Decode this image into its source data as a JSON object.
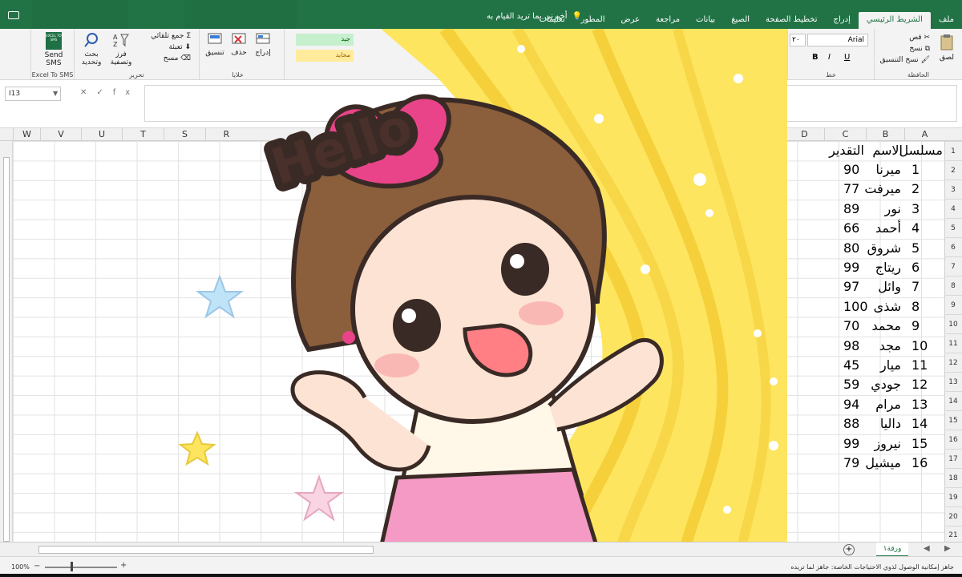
{
  "titlebar": {
    "tabs": [
      "ملف",
      "الشريط الرئيسي",
      "إدراج",
      "تخطيط الصفحة",
      "الصيغ",
      "بيانات",
      "مراجعة",
      "عرض",
      "المطور",
      "تعليمات"
    ],
    "active_tab": "الشريط الرئيسي",
    "tell_me": "أخبرني بما تريد القيام به"
  },
  "ribbon": {
    "clipboard": {
      "paste": "لصق",
      "cut": "قص",
      "copy": "نسخ",
      "format_painter": "نسخ التنسيق",
      "label": "الحافظة"
    },
    "font": {
      "name": "Arial",
      "size": "٢٠",
      "bold": "B",
      "italic": "I",
      "underline": "U",
      "label": "خط"
    },
    "styles": {
      "good": "جيد",
      "neutral": "محايد"
    },
    "cells": {
      "insert": "إدراج",
      "delete": "حذف",
      "format": "تنسيق",
      "label": "خلايا"
    },
    "editing": {
      "autosum": "جمع تلقائي",
      "fill": "تعبئة",
      "clear": "مسح",
      "sort": "فرز وتصفية",
      "find": "بحث وتحديد",
      "label": "تحرير"
    },
    "sms": {
      "logo": "EXCEL TO SMS",
      "button": "Send SMS",
      "label": "Excel To SMS"
    }
  },
  "formula_bar": {
    "name_box": "I13",
    "fx": "fx",
    "value": ""
  },
  "columns": [
    "A",
    "B",
    "C",
    "D",
    "R",
    "S",
    "T",
    "U",
    "V",
    "W"
  ],
  "rows": [
    "1",
    "2",
    "3",
    "4",
    "5",
    "6",
    "7",
    "8",
    "9",
    "10",
    "11",
    "12",
    "13",
    "14",
    "15",
    "16",
    "17",
    "18",
    "19",
    "20",
    "21"
  ],
  "table": {
    "headers": [
      "مسلسل",
      "الاسم",
      "التقدير"
    ],
    "rows": [
      [
        "1",
        "ميرنا",
        "90"
      ],
      [
        "2",
        "ميرفت",
        "77"
      ],
      [
        "3",
        "نور",
        "89"
      ],
      [
        "4",
        "أحمد",
        "66"
      ],
      [
        "5",
        "شروق",
        "80"
      ],
      [
        "6",
        "ريتاج",
        "99"
      ],
      [
        "7",
        "وائل",
        "97"
      ],
      [
        "8",
        "شذى",
        "100"
      ],
      [
        "9",
        "محمد",
        "70"
      ],
      [
        "10",
        "مجد",
        "98"
      ],
      [
        "11",
        "ميار",
        "45"
      ],
      [
        "12",
        "جودي",
        "59"
      ],
      [
        "13",
        "مرام",
        "94"
      ],
      [
        "14",
        "داليا",
        "88"
      ],
      [
        "15",
        "نيروز",
        "99"
      ],
      [
        "16",
        "ميشيل",
        "79"
      ]
    ]
  },
  "sticker": {
    "text": "Hello"
  },
  "sheet_tab": "ورقة١",
  "status": {
    "text": "جاهز   إمكانية الوصول لذوي الاحتياجات الخاصة: جاهز لما تريده",
    "zoom": "100%"
  },
  "colors": {
    "excel_green": "#217346",
    "curtain": "#fde560",
    "bow": "#e9448a"
  }
}
